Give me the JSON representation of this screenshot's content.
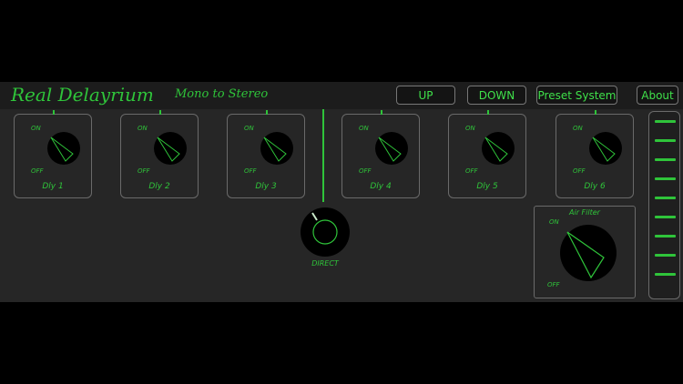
{
  "header": {
    "title": "Real Delayrium",
    "subtitle": "Mono to Stereo",
    "buttons": {
      "up": "UP",
      "down": "DOWN",
      "preset": "Preset System",
      "about": "About"
    }
  },
  "delays": [
    {
      "name": "Dly 1",
      "on": "ON",
      "off": "OFF"
    },
    {
      "name": "Dly 2",
      "on": "ON",
      "off": "OFF"
    },
    {
      "name": "Dly 3",
      "on": "ON",
      "off": "OFF"
    },
    {
      "name": "Dly 4",
      "on": "ON",
      "off": "OFF"
    },
    {
      "name": "Dly 5",
      "on": "ON",
      "off": "OFF"
    },
    {
      "name": "Dly 6",
      "on": "ON",
      "off": "OFF"
    }
  ],
  "direct": {
    "label": "DIRECT"
  },
  "air_filter": {
    "title": "Air Filter",
    "on": "ON",
    "off": "OFF"
  },
  "meter": {
    "segments": 9
  },
  "colors": {
    "accent": "#2fc43a",
    "panel": "#262626",
    "knob": "#000000"
  }
}
